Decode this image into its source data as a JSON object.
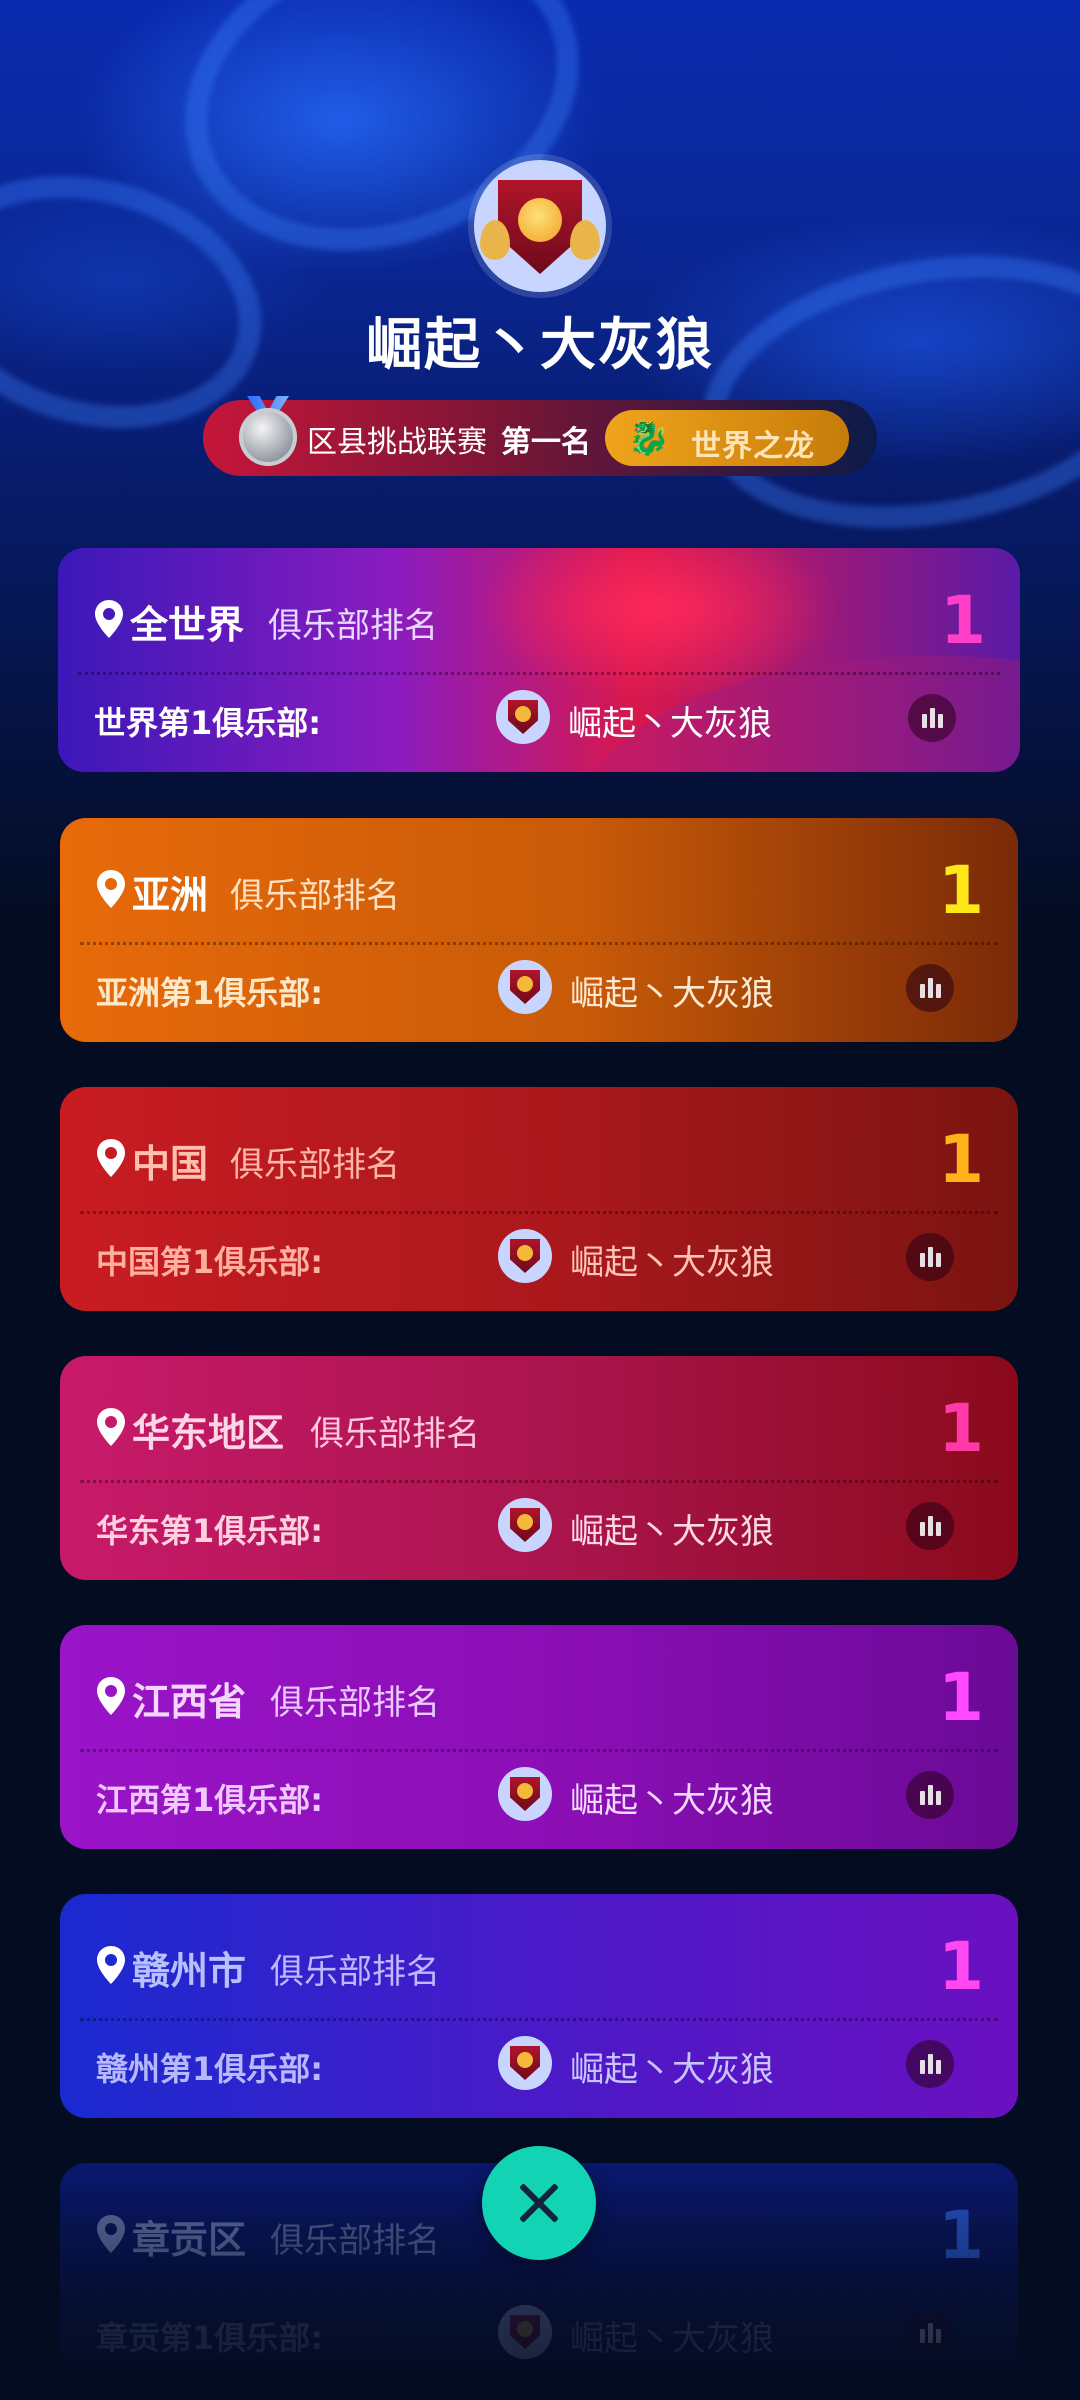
{
  "header": {
    "club_name": "崛起丶大灰狼",
    "league": {
      "name": "区县挑战联赛",
      "rank_text": "第一名",
      "title_badge": "世界之龙"
    }
  },
  "rankings": [
    {
      "region": "全世界",
      "subtitle": "俱乐部排名",
      "rank": "1",
      "label": "世界第1俱乐部:",
      "club": "崛起丶大灰狼",
      "rank_color": "#ff3fc8",
      "label_color": "#ffffff",
      "region_color": "#ffffff"
    },
    {
      "region": "亚洲",
      "subtitle": "俱乐部排名",
      "rank": "1",
      "label": "亚洲第1俱乐部:",
      "club": "崛起丶大灰狼",
      "rank_color": "#ffe81a",
      "label_color": "#ffe8c8",
      "region_color": "#ffffff"
    },
    {
      "region": "中国",
      "subtitle": "俱乐部排名",
      "rank": "1",
      "label": "中国第1俱乐部:",
      "club": "崛起丶大灰狼",
      "rank_color": "#ffb21a",
      "label_color": "#ffb0a0",
      "region_color": "#ffc0b0"
    },
    {
      "region": "华东地区",
      "subtitle": "俱乐部排名",
      "rank": "1",
      "label": "华东第1俱乐部:",
      "club": "崛起丶大灰狼",
      "rank_color": "#ff3aa8",
      "label_color": "#ffd0e0",
      "region_color": "#ffd6e6"
    },
    {
      "region": "江西省",
      "subtitle": "俱乐部排名",
      "rank": "1",
      "label": "江西第1俱乐部:",
      "club": "崛起丶大灰狼",
      "rank_color": "#ff48ff",
      "label_color": "#f0c8ff",
      "region_color": "#f4d6ff"
    },
    {
      "region": "赣州市",
      "subtitle": "俱乐部排名",
      "rank": "1",
      "label": "赣州第1俱乐部:",
      "club": "崛起丶大灰狼",
      "rank_color": "#ff48f0",
      "label_color": "#b8b8ff",
      "region_color": "#b8c0ff"
    },
    {
      "region": "章贡区",
      "subtitle": "俱乐部排名",
      "rank": "1",
      "label": "章贡第1俱乐部:",
      "club": "崛起丶大灰狼",
      "rank_color": "#2a5ad8",
      "label_color": "#5a6a9a",
      "region_color": "#6a7ab0"
    }
  ],
  "icons": {
    "club_logo": "lion-shield-icon",
    "medal": "silver-medal-icon",
    "badge": "dragon-icon",
    "location": "location-pin-icon",
    "stats": "bar-chart-icon",
    "close": "close-icon"
  }
}
